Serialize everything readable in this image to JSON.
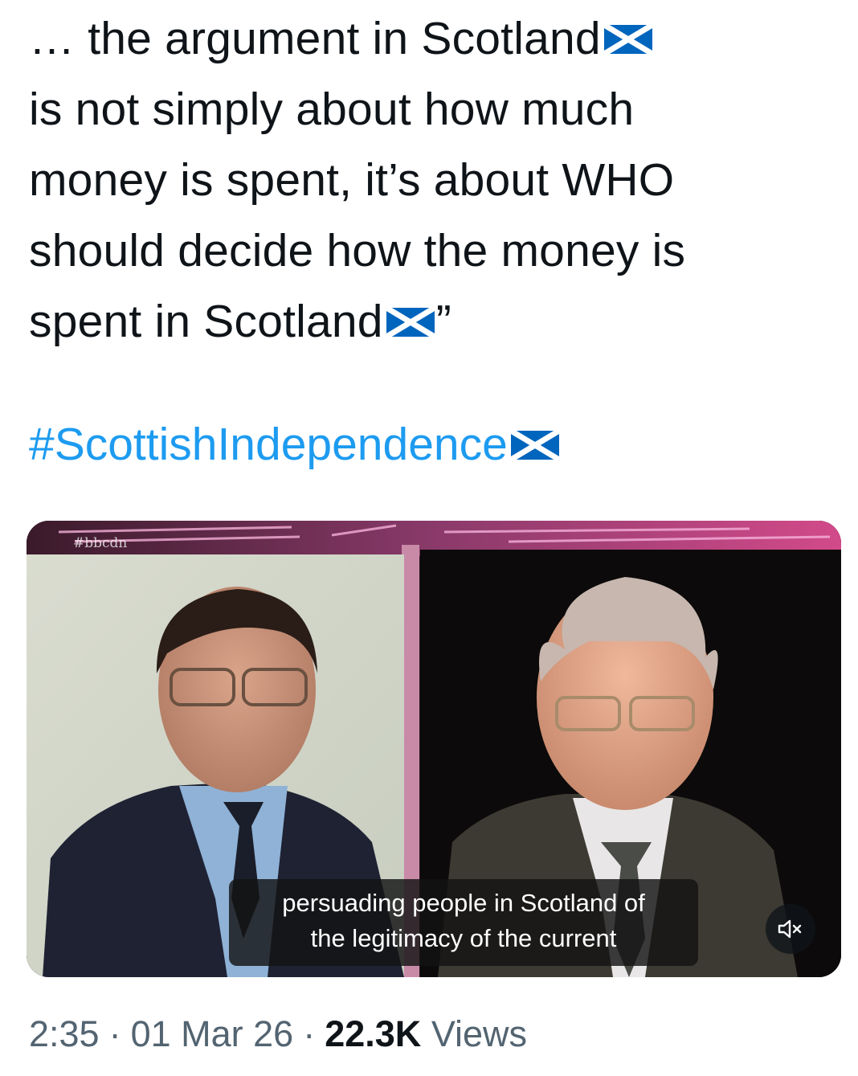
{
  "tweet": {
    "line1": "… the argument in Scotland",
    "line2": "is not simply about how much",
    "line3": "money is spent, it’s about WHO",
    "line4": "should decide how the money is",
    "line5_text": "spent in Scotland",
    "line5_suffix": "”",
    "hashtag": "#ScottishIndependence"
  },
  "video": {
    "watermark": "#bbcdn",
    "caption_line1": "persuading people in Scotland of",
    "caption_line2": "the legitimacy of the current",
    "mute_icon": "speaker-muted-icon"
  },
  "meta": {
    "time": "2:35",
    "date": "01 Mar 26",
    "views_count": "22.3K",
    "views_label": "Views",
    "separator": "·"
  },
  "colors": {
    "text": "#0f1419",
    "link": "#1d9bf0",
    "secondary": "#536471",
    "saltire_blue": "#0065bd"
  }
}
